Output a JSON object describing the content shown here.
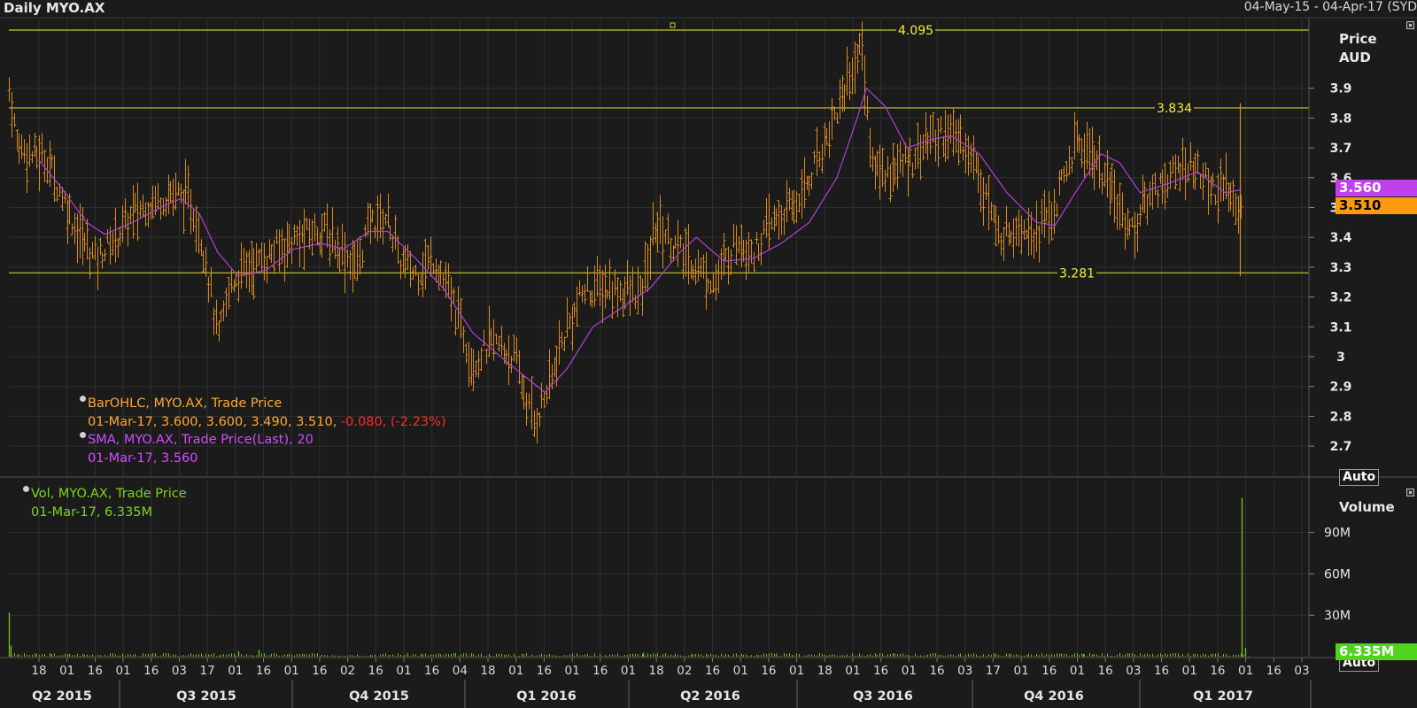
{
  "header": {
    "title": "Daily MYO.AX",
    "date_range": "04-May-15 - 04-Apr-17 (SYD"
  },
  "price_axis": {
    "label_line1": "Price",
    "label_line2": "AUD",
    "auto_label": "Auto",
    "ticks": [
      "2.7",
      "2.8",
      "2.9",
      "3",
      "3.1",
      "3.2",
      "3.3",
      "3.4",
      "3.5",
      "3.6",
      "3.7",
      "3.8",
      "3.9"
    ]
  },
  "volume_axis": {
    "label": "Volume",
    "auto_label": "Auto",
    "ticks": [
      "30M",
      "60M",
      "90M"
    ]
  },
  "badges": {
    "sma_value": "3.560",
    "price_value": "3.510",
    "volume_value": "6.335M"
  },
  "legend": {
    "ohlc_title": "BarOHLC, MYO.AX, Trade Price",
    "ohlc_values": "01-Mar-17, 3.600, 3.600, 3.490, 3.510,",
    "ohlc_change": " -0.080, (-2.23%)",
    "sma_title": "SMA, MYO.AX, Trade Price(Last),  20",
    "sma_values": "01-Mar-17, 3.560",
    "vol_title": "Vol, MYO.AX, Trade Price",
    "vol_values": "01-Mar-17, 6.335M"
  },
  "colors": {
    "background": "#1b1b1b",
    "grid": "#2f2f2f",
    "ohlc": "#d88a1e",
    "sma": "#b040d8",
    "hline": "#c8c830",
    "volume": "#6ec21a",
    "sma_badge": "#c040f0",
    "price_badge": "#ff9a10",
    "volume_badge": "#4ed41a"
  },
  "x_axis": {
    "day_ticks": [
      "18",
      "01",
      "16",
      "01",
      "16",
      "03",
      "17",
      "01",
      "16",
      "01",
      "16",
      "02",
      "16",
      "01",
      "16",
      "04",
      "18",
      "01",
      "16",
      "01",
      "16",
      "01",
      "18",
      "02",
      "16",
      "01",
      "16",
      "01",
      "18",
      "01",
      "16",
      "01",
      "16",
      "03",
      "17",
      "01",
      "16",
      "01",
      "16",
      "03",
      "16",
      "01",
      "16",
      "01",
      "16",
      "03"
    ],
    "quarters": [
      "Q2 2015",
      "Q3 2015",
      "Q4 2015",
      "Q1 2016",
      "Q2 2016",
      "Q3 2016",
      "Q4 2016",
      "Q1 2017"
    ]
  },
  "chart_data": {
    "type": "ohlc",
    "symbol": "MYO.AX",
    "currency": "AUD",
    "period": "daily",
    "price_ylim": [
      2.65,
      4.1
    ],
    "volume_ylim": [
      0,
      115
    ],
    "volume_units": "M",
    "horizontal_lines": [
      {
        "value": 4.095,
        "label": "4.095"
      },
      {
        "value": 3.834,
        "label": "3.834"
      },
      {
        "value": 3.281,
        "label": "3.281"
      }
    ],
    "price_path": [
      [
        "2015-05-04",
        3.9
      ],
      [
        "2015-05-08",
        3.72
      ],
      [
        "2015-05-15",
        3.68
      ],
      [
        "2015-05-25",
        3.66
      ],
      [
        "2015-06-01",
        3.55
      ],
      [
        "2015-06-10",
        3.42
      ],
      [
        "2015-06-20",
        3.33
      ],
      [
        "2015-07-01",
        3.4
      ],
      [
        "2015-07-10",
        3.48
      ],
      [
        "2015-07-20",
        3.52
      ],
      [
        "2015-08-01",
        3.55
      ],
      [
        "2015-08-10",
        3.52
      ],
      [
        "2015-08-18",
        3.35
      ],
      [
        "2015-08-25",
        3.05
      ],
      [
        "2015-09-01",
        3.25
      ],
      [
        "2015-09-10",
        3.3
      ],
      [
        "2015-09-20",
        3.33
      ],
      [
        "2015-10-01",
        3.38
      ],
      [
        "2015-10-10",
        3.4
      ],
      [
        "2015-10-20",
        3.43
      ],
      [
        "2015-11-01",
        3.35
      ],
      [
        "2015-11-08",
        3.3
      ],
      [
        "2015-11-15",
        3.45
      ],
      [
        "2015-11-25",
        3.47
      ],
      [
        "2015-12-01",
        3.32
      ],
      [
        "2015-12-10",
        3.28
      ],
      [
        "2015-12-20",
        3.33
      ],
      [
        "2016-01-01",
        3.15
      ],
      [
        "2016-01-10",
        2.98
      ],
      [
        "2016-01-20",
        3.05
      ],
      [
        "2016-02-01",
        3.0
      ],
      [
        "2016-02-08",
        2.85
      ],
      [
        "2016-02-12",
        2.78
      ],
      [
        "2016-02-20",
        2.9
      ],
      [
        "2016-03-01",
        3.1
      ],
      [
        "2016-03-10",
        3.22
      ],
      [
        "2016-03-20",
        3.23
      ],
      [
        "2016-04-01",
        3.22
      ],
      [
        "2016-04-10",
        3.2
      ],
      [
        "2016-04-18",
        3.45
      ],
      [
        "2016-05-01",
        3.35
      ],
      [
        "2016-05-10",
        3.3
      ],
      [
        "2016-05-20",
        3.25
      ],
      [
        "2016-06-01",
        3.4
      ],
      [
        "2016-06-10",
        3.35
      ],
      [
        "2016-06-20",
        3.45
      ],
      [
        "2016-07-01",
        3.5
      ],
      [
        "2016-07-10",
        3.6
      ],
      [
        "2016-07-20",
        3.75
      ],
      [
        "2016-08-01",
        3.95
      ],
      [
        "2016-08-08",
        4.05
      ],
      [
        "2016-08-12",
        3.65
      ],
      [
        "2016-08-20",
        3.62
      ],
      [
        "2016-09-01",
        3.65
      ],
      [
        "2016-09-10",
        3.72
      ],
      [
        "2016-09-20",
        3.75
      ],
      [
        "2016-10-01",
        3.72
      ],
      [
        "2016-10-10",
        3.62
      ],
      [
        "2016-10-20",
        3.4
      ],
      [
        "2016-11-01",
        3.45
      ],
      [
        "2016-11-10",
        3.42
      ],
      [
        "2016-11-20",
        3.5
      ],
      [
        "2016-12-01",
        3.72
      ],
      [
        "2016-12-10",
        3.68
      ],
      [
        "2016-12-20",
        3.55
      ],
      [
        "2017-01-01",
        3.42
      ],
      [
        "2017-01-10",
        3.55
      ],
      [
        "2017-01-20",
        3.6
      ],
      [
        "2017-02-01",
        3.65
      ],
      [
        "2017-02-10",
        3.58
      ],
      [
        "2017-02-20",
        3.55
      ],
      [
        "2017-03-01",
        3.51
      ]
    ],
    "sma_path": [
      [
        "2015-05-20",
        3.66
      ],
      [
        "2015-06-01",
        3.57
      ],
      [
        "2015-06-15",
        3.45
      ],
      [
        "2015-06-25",
        3.41
      ],
      [
        "2015-07-10",
        3.45
      ],
      [
        "2015-07-25",
        3.5
      ],
      [
        "2015-08-05",
        3.53
      ],
      [
        "2015-08-15",
        3.48
      ],
      [
        "2015-08-25",
        3.35
      ],
      [
        "2015-09-05",
        3.27
      ],
      [
        "2015-09-20",
        3.29
      ],
      [
        "2015-10-05",
        3.36
      ],
      [
        "2015-10-20",
        3.38
      ],
      [
        "2015-11-01",
        3.36
      ],
      [
        "2015-11-15",
        3.42
      ],
      [
        "2015-11-25",
        3.42
      ],
      [
        "2015-12-10",
        3.33
      ],
      [
        "2015-12-25",
        3.23
      ],
      [
        "2016-01-10",
        3.08
      ],
      [
        "2016-01-25",
        3.0
      ],
      [
        "2016-02-10",
        2.92
      ],
      [
        "2016-02-18",
        2.88
      ],
      [
        "2016-03-01",
        2.96
      ],
      [
        "2016-03-15",
        3.1
      ],
      [
        "2016-04-01",
        3.17
      ],
      [
        "2016-04-15",
        3.23
      ],
      [
        "2016-05-01",
        3.35
      ],
      [
        "2016-05-10",
        3.4
      ],
      [
        "2016-05-25",
        3.32
      ],
      [
        "2016-06-10",
        3.33
      ],
      [
        "2016-06-25",
        3.38
      ],
      [
        "2016-07-10",
        3.45
      ],
      [
        "2016-07-25",
        3.6
      ],
      [
        "2016-08-05",
        3.8
      ],
      [
        "2016-08-10",
        3.9
      ],
      [
        "2016-08-20",
        3.84
      ],
      [
        "2016-09-01",
        3.7
      ],
      [
        "2016-09-15",
        3.73
      ],
      [
        "2016-09-25",
        3.74
      ],
      [
        "2016-10-10",
        3.68
      ],
      [
        "2016-10-25",
        3.55
      ],
      [
        "2016-11-10",
        3.45
      ],
      [
        "2016-11-20",
        3.44
      ],
      [
        "2016-12-01",
        3.55
      ],
      [
        "2016-12-15",
        3.68
      ],
      [
        "2016-12-25",
        3.65
      ],
      [
        "2017-01-05",
        3.55
      ],
      [
        "2017-01-20",
        3.58
      ],
      [
        "2017-02-05",
        3.62
      ],
      [
        "2017-02-20",
        3.55
      ],
      [
        "2017-03-01",
        3.56
      ]
    ],
    "volume_spikes": [
      [
        "2015-05-04",
        32
      ],
      [
        "2015-05-05",
        8
      ],
      [
        "2015-07-22",
        2
      ],
      [
        "2015-09-05",
        4
      ],
      [
        "2015-09-16",
        5
      ],
      [
        "2016-04-11",
        3
      ],
      [
        "2016-12-05",
        2
      ],
      [
        "2017-03-01",
        115
      ],
      [
        "2017-03-03",
        6.335
      ]
    ]
  }
}
